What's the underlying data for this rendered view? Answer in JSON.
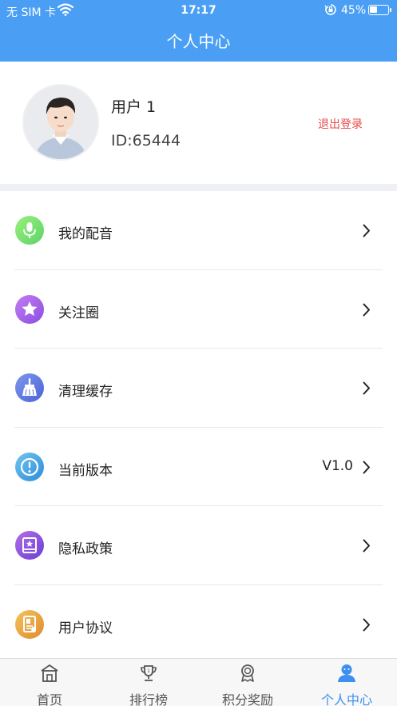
{
  "status_bar": {
    "carrier": "无 SIM 卡",
    "time": "17:17",
    "battery": "45%",
    "battery_level": 0.45
  },
  "header": {
    "title": "个人中心"
  },
  "profile": {
    "name": "用户 1",
    "id": "ID:65444",
    "logout_label": "退出登录"
  },
  "menu": [
    {
      "label": "我的配音",
      "icon": "microphone-icon",
      "value": ""
    },
    {
      "label": "关注圈",
      "icon": "star-icon",
      "value": ""
    },
    {
      "label": "清理缓存",
      "icon": "broom-icon",
      "value": ""
    },
    {
      "label": "当前版本",
      "icon": "info-icon",
      "value": "V1.0"
    },
    {
      "label": "隐私政策",
      "icon": "privacy-book-icon",
      "value": ""
    },
    {
      "label": "用户协议",
      "icon": "agreement-document-icon",
      "value": ""
    }
  ],
  "tabbar": {
    "tabs": [
      {
        "label": "首页",
        "icon": "home-icon"
      },
      {
        "label": "排行榜",
        "icon": "trophy-icon"
      },
      {
        "label": "积分奖励",
        "icon": "medal-icon"
      },
      {
        "label": "个人中心",
        "icon": "user-icon"
      }
    ],
    "active_index": 3
  },
  "colors": {
    "primary": "#4a9ff5",
    "logout": "#e84b4b",
    "tab_active": "#3d8ff0"
  }
}
